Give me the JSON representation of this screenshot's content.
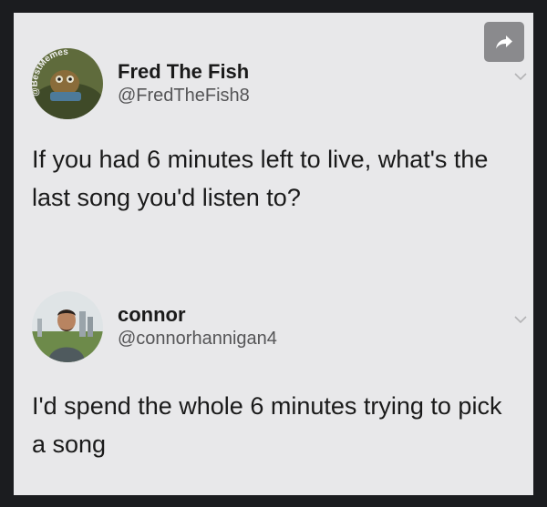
{
  "share": {
    "icon": "share-arrow-icon"
  },
  "tweets": [
    {
      "display_name": "Fred The Fish",
      "handle": "@FredTheFish8",
      "avatar_text": "@BestMemes",
      "text": "If you had 6 minutes left to live, what's the last song you'd listen to?"
    },
    {
      "display_name": "connor",
      "handle": "@connorhannigan4",
      "text": "I'd spend the whole 6 minutes trying to pick a song"
    }
  ],
  "colors": {
    "background": "#1b1c1f",
    "card": "#e8e8ea",
    "share_button": "#8a8a8d",
    "text": "#1a1a1a",
    "handle": "#555557"
  }
}
